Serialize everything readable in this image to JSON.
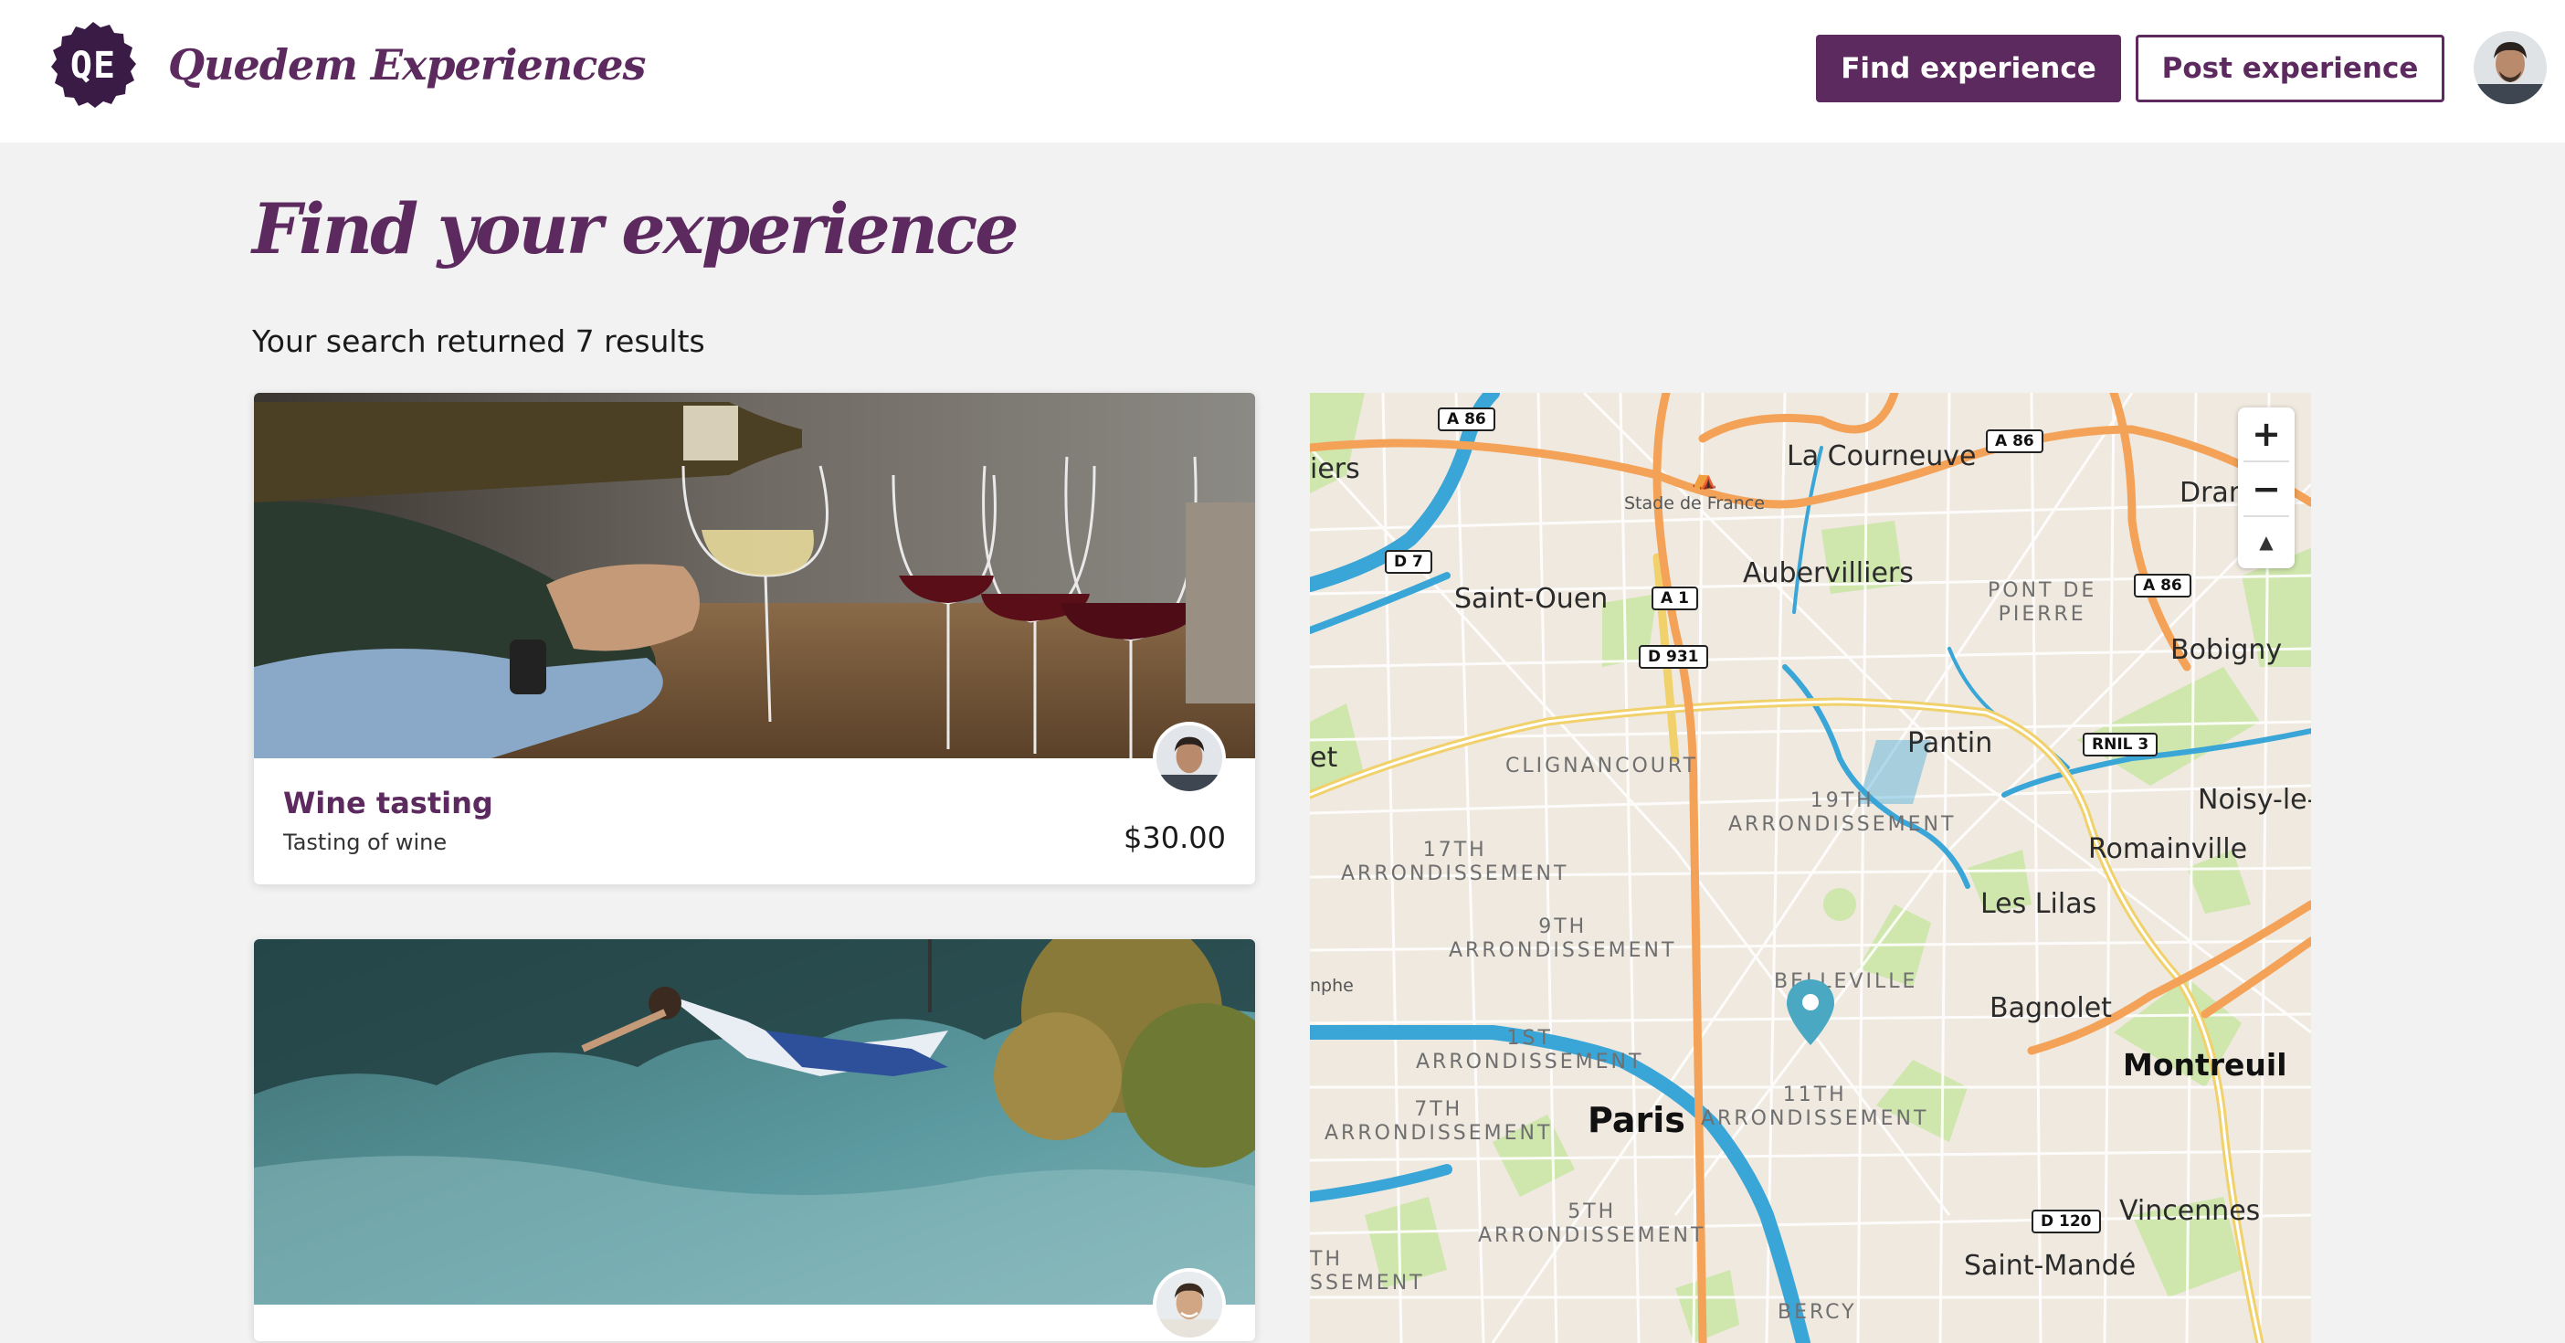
{
  "header": {
    "logo_text": "QE",
    "brand": "Quedem Experiences",
    "find_button": "Find experience",
    "post_button": "Post experience"
  },
  "main": {
    "title": "Find your experience",
    "result_text": "Your search returned 7 results"
  },
  "cards": [
    {
      "title": "Wine tasting",
      "subtitle": "Tasting of wine",
      "price": "$30.00"
    },
    {
      "title": "",
      "subtitle": "",
      "price": ""
    }
  ],
  "map": {
    "labels": {
      "la_courneuve": "La Courneuve",
      "stade": "Stade de France",
      "saint_ouen": "Saint-Ouen",
      "aubervilliers": "Aubervilliers",
      "pont_de_pierre": "PONT DE\nPIERRE",
      "bobigny": "Bobigny",
      "drancy": "Dran",
      "iers": "iers",
      "et": "et",
      "pantin": "Pantin",
      "clignancourt": "CLIGNANCOURT",
      "arr19": "19TH\nARRONDISSEMENT",
      "arr17": "17TH\nARRONDISSEMENT",
      "noisy": "Noisy-le-",
      "romainville": "Romainville",
      "les_lilas": "Les Lilas",
      "arr9": "9TH\nARRONDISSEMENT",
      "belleville": "BELLEVILLE",
      "nphe": "nphe",
      "bagnolet": "Bagnolet",
      "arr1": "1ST\nARRONDISSEMENT",
      "montreuil": "Montreuil",
      "arr7": "7TH\nARRONDISSEMENT",
      "paris": "Paris",
      "arr11": "11TH\nARRONDISSEMENT",
      "arr5": "5TH\nARRONDISSEMENT",
      "vincennes": "Vincennes",
      "th_ssement": "TH\nSSEMENT",
      "saint_mande": "Saint-Mandé",
      "bercy": "BERCY"
    },
    "roads": {
      "a86_1": "A 86",
      "a86_2": "A 86",
      "a86_3": "A 86",
      "d7": "D 7",
      "a1": "A 1",
      "d931": "D 931",
      "rnil3": "RNIL 3",
      "d120": "D 120"
    },
    "controls": {
      "zoom_in": "+",
      "zoom_out": "−",
      "compass": "▲"
    }
  },
  "colors": {
    "brand": "#5c2a5e",
    "page_bg": "#f2f2f2",
    "map_land": "#efe9df",
    "map_water": "#3aa6d8",
    "map_highway": "#f3a257",
    "map_major": "#f1d16b",
    "map_park": "#cfe6ad",
    "pin": "#4aa8c2"
  },
  "icons": {
    "zoom_in": "plus-icon",
    "zoom_out": "minus-icon",
    "compass": "compass-icon",
    "pin": "map-pin-icon",
    "stadium": "stadium-icon"
  }
}
